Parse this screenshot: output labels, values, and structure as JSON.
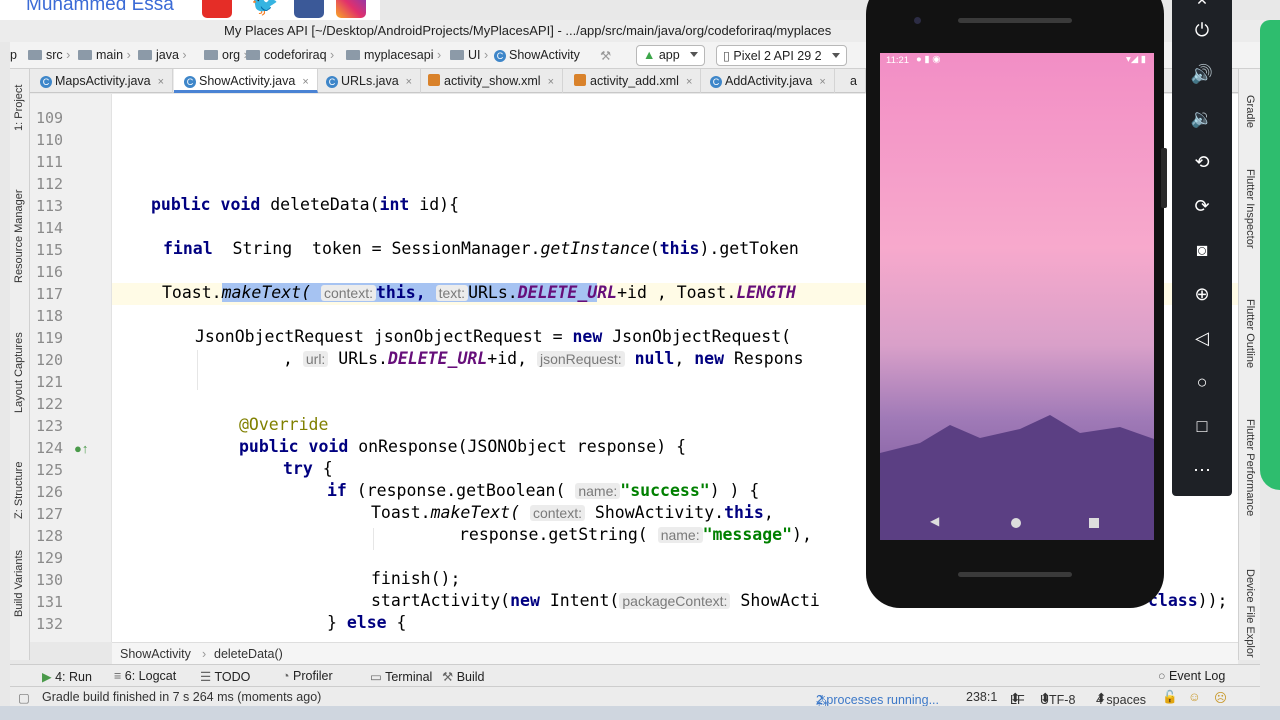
{
  "branding": {
    "name": "Muhammed Essa"
  },
  "window": {
    "title": "My Places API [~/Desktop/AndroidProjects/MyPlacesAPI] - .../app/src/main/java/org/codeforiraq/myplaces"
  },
  "nav": {
    "crumbs": [
      "p",
      "src",
      "main",
      "java",
      "org",
      "codeforiraq",
      "myplacesapi",
      "UI",
      "ShowActivity"
    ],
    "run_config": "app",
    "device": "Pixel 2 API 29 2"
  },
  "tabs": [
    "MapsActivity.java",
    "ShowActivity.java",
    "URLs.java",
    "activity_show.xml",
    "activity_add.xml",
    "AddActivity.java",
    "a"
  ],
  "left_tools": [
    "1: Project",
    "Resource Manager",
    "Layout Captures",
    "Z: Structure",
    "Build Variants"
  ],
  "right_tools": [
    "Gradle",
    "Flutter Inspector",
    "Flutter Outline",
    "Flutter Performance",
    "Device File Explor"
  ],
  "line_numbers": [
    "109",
    "110",
    "111",
    "112",
    "113",
    "114",
    "115",
    "116",
    "117",
    "118",
    "119",
    "120",
    "121",
    "122",
    "123",
    "124",
    "125",
    "126",
    "127",
    "128",
    "129",
    "130",
    "131",
    "132"
  ],
  "code": {
    "l113": {
      "kw1": "public",
      "kw2": "void",
      "rest": " deleteData(",
      "kw3": "int",
      "rest2": " id){"
    },
    "l115": {
      "kw1": "final",
      "rest": "  String  token = SessionManager.",
      "it": "getInstance",
      "rest2": "(",
      "kw2": "this",
      "rest3": ").getToken"
    },
    "l117": {
      "pre": "Toast.",
      "it": "makeText(",
      "hint1": "context:",
      "kw": "this,",
      "hint2": "text:",
      "a": "URLs.",
      "const": "DELETE_U",
      "const2": "RL",
      "b": "+id , Toast.",
      "const3": "LENGTH"
    },
    "l119": {
      "a": "JsonObjectRequest jsonObjectRequest = ",
      "kw": "new",
      "b": " JsonObjectRequest("
    },
    "l120": {
      "a": ", ",
      "hint1": "url:",
      "b": " URLs.",
      "const": "DELETE_URL",
      "c": "+id, ",
      "hint2": "jsonRequest:",
      "kw": " null",
      "d": ", ",
      "kw2": "new",
      "e": " Respons"
    },
    "l123": {
      "ann": "@Override"
    },
    "l124": {
      "kw1": "public",
      "kw2": "void",
      "rest": " onResponse(JSONObject response) {"
    },
    "l125": {
      "kw": "try",
      "rest": " {"
    },
    "l126": {
      "kw": "if",
      "a": " (response.getBoolean(",
      "hint": "name:",
      "str": "\"success\"",
      "b": ") ) {"
    },
    "l127": {
      "a": "Toast.",
      "it": "makeText(",
      "hint": "context:",
      "b": " ShowActivity.",
      "kw": "this",
      "c": ","
    },
    "l128": {
      "a": "response.getString(",
      "hint": "name:",
      "str": "\"message\"",
      "b": "),"
    },
    "l130": {
      "a": "finish();"
    },
    "l131": {
      "a": "startActivity(",
      "kw": "new",
      "b": " Intent(",
      "hint": "packageContext:",
      "c": " ShowActi",
      "kw2": "class",
      "d": "));"
    },
    "l132": {
      "a": "} ",
      "kw": "else",
      "b": " {"
    }
  },
  "editor_breadcrumb": [
    "ShowActivity",
    "deleteData()"
  ],
  "bottom_tools": [
    "4: Run",
    "6: Logcat",
    "TODO",
    "Profiler",
    "Terminal",
    "Build",
    "Event Log"
  ],
  "status": {
    "message": "Gradle build finished in 7 s 264 ms (moments ago)",
    "processes": "2 processes running...",
    "position": "238:1",
    "line_sep": "LF",
    "encoding": "UTF-8",
    "indent": "4 spaces"
  },
  "emulator": {
    "clock": "11:21"
  }
}
